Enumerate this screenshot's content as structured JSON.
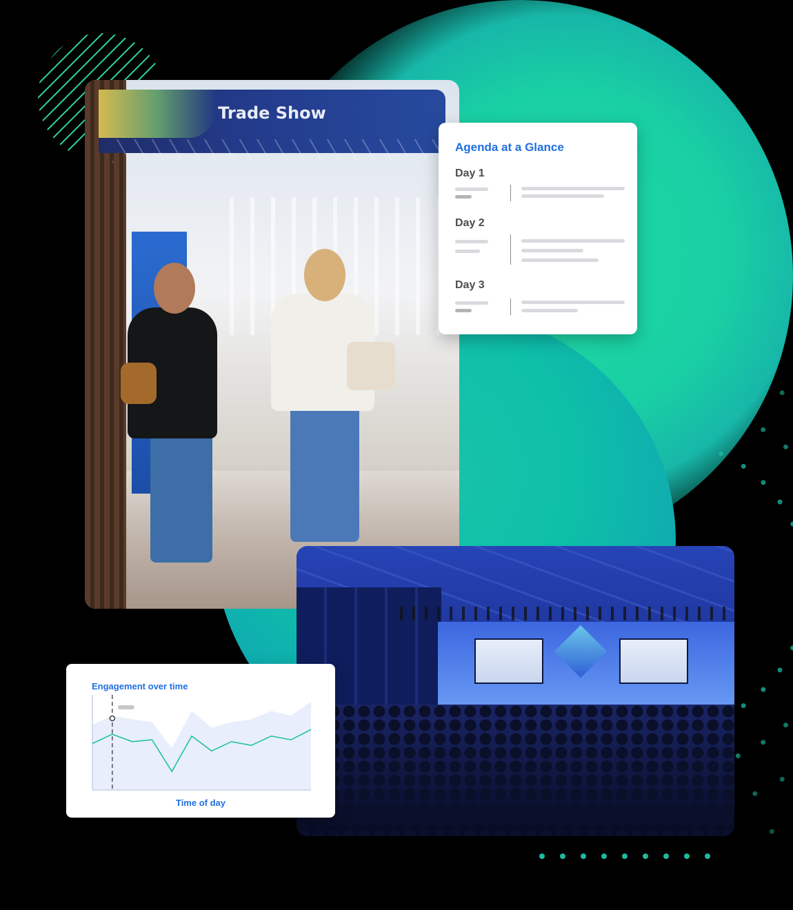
{
  "colors": {
    "accent": "#1f6fe0",
    "teal": "#1fd8a2",
    "chart_line": "#22c39a",
    "chart_fill": "#e8eefc"
  },
  "trade_show_photo": {
    "banner_title": "Trade Show"
  },
  "agenda": {
    "title": "Agenda at a Glance",
    "days": [
      {
        "label": "Day 1"
      },
      {
        "label": "Day 2"
      },
      {
        "label": "Day 3"
      }
    ]
  },
  "engagement_chart": {
    "title": "Engagement over time",
    "xlabel": "Time of day",
    "chart_data": {
      "type": "area",
      "title": "Engagement over time",
      "xlabel": "Time of day",
      "ylabel": "",
      "x": [
        0,
        1,
        2,
        3,
        4,
        5,
        6,
        7,
        8,
        9,
        10,
        11
      ],
      "series": [
        {
          "values": [
            5.0,
            6.0,
            5.2,
            5.4,
            2.0,
            5.8,
            4.2,
            5.2,
            4.8,
            5.8,
            5.4,
            6.5
          ]
        },
        {
          "values": [
            7.0,
            8.0,
            7.6,
            7.3,
            4.5,
            8.5,
            6.7,
            7.3,
            7.6,
            8.5,
            8.0,
            9.5
          ]
        }
      ],
      "highlight_x": 1,
      "ylim": [
        0,
        10
      ],
      "grid": false
    }
  }
}
